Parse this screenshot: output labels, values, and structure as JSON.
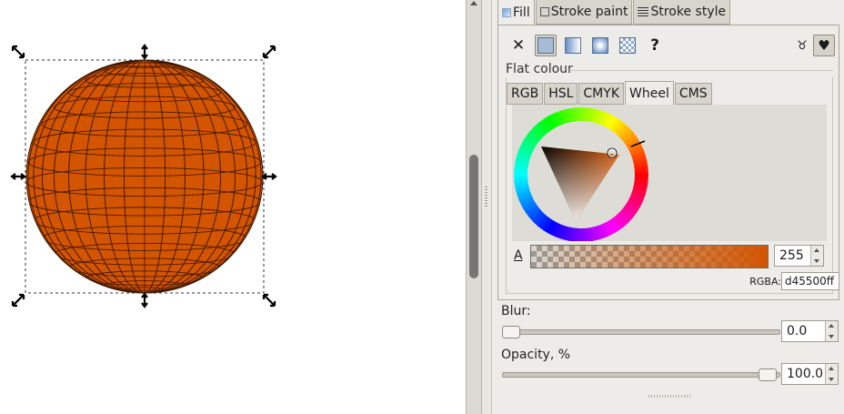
{
  "tabs": [
    {
      "label": "Fill",
      "icon": "fill-icon"
    },
    {
      "label": "Stroke paint",
      "icon": "stroke-paint-icon"
    },
    {
      "label": "Stroke style",
      "icon": "stroke-style-icon"
    }
  ],
  "paint_modes": [
    "no-paint-icon",
    "flat-color-icon",
    "linear-gradient-icon",
    "radial-gradient-icon",
    "pattern-icon",
    "unset-icon"
  ],
  "fill_rule_icons": [
    "fill-rule-evenodd-icon",
    "fill-rule-nonzero-icon"
  ],
  "flat_colour_label": "Flat colour",
  "color_tabs": [
    "RGB",
    "HSL",
    "CMYK",
    "Wheel",
    "CMS"
  ],
  "active_color_tab": "Wheel",
  "alpha": {
    "label": "A",
    "value": "255"
  },
  "rgba": {
    "label": "RGBA:",
    "value": "d45500ff"
  },
  "blur": {
    "label": "Blur:",
    "value": "0.0",
    "level": 0
  },
  "opacity": {
    "label": "Opacity, %",
    "value": "100.0",
    "level": 1.0
  },
  "colors": {
    "fill": "#d45500",
    "sphere_lines": "#3a1600",
    "panel": "#edece8"
  },
  "handle_icons": [
    "scale-arrow-nw-icon",
    "scale-arrow-n-icon",
    "scale-arrow-ne-icon",
    "scale-arrow-w-icon",
    "scale-arrow-e-icon",
    "scale-arrow-sw-icon",
    "scale-arrow-s-icon",
    "scale-arrow-se-icon"
  ]
}
